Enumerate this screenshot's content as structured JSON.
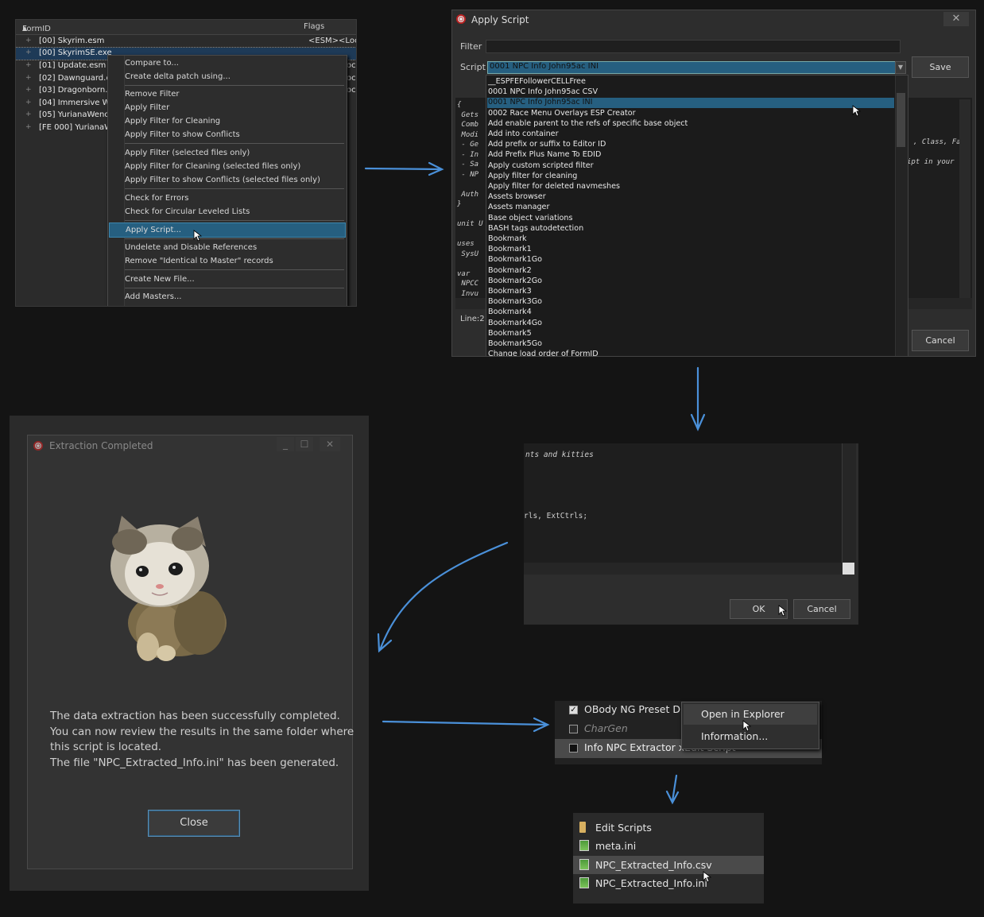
{
  "panel1": {
    "col_formid": "FormID",
    "col_flags": "Flags",
    "rows": [
      {
        "name": "[00] Skyrim.esm",
        "flags": "<ESM><Loc",
        "oc": ""
      },
      {
        "name": "[00] SkyrimSE.exe",
        "flags": "",
        "oc": ""
      },
      {
        "name": "[01] Update.esm",
        "flags": "",
        "oc": "oc"
      },
      {
        "name": "[02] Dawnguard.e",
        "flags": "",
        "oc": "oc"
      },
      {
        "name": "[03] Dragonborn.e",
        "flags": "",
        "oc": "oc"
      },
      {
        "name": "[04] Immersive W",
        "flags": "",
        "oc": ""
      },
      {
        "name": "[05] YurianaWencl",
        "flags": "",
        "oc": ""
      },
      {
        "name": "[FE 000] YurianaW",
        "flags": "",
        "oc": ""
      }
    ],
    "menu": [
      "Compare to...",
      "Create delta patch using...",
      "Remove Filter",
      "Apply Filter",
      "Apply Filter for Cleaning",
      "Apply Filter to show Conflicts",
      "Apply Filter (selected files only)",
      "Apply Filter for Cleaning (selected files only)",
      "Apply Filter to show Conflicts (selected files only)",
      "Check for Errors",
      "Check for Circular Leveled Lists",
      "Apply Script...",
      "Undelete and Disable References",
      "Remove \"Identical to Master\" records",
      "Create New File...",
      "Add Masters..."
    ]
  },
  "panel2": {
    "title": "Apply Script",
    "filter_label": "Filter",
    "script_label": "Script",
    "selected_script": "0001 NPC Info John95ac INI",
    "save_label": "Save",
    "cancel_label": "Cancel",
    "status": "Line:2",
    "code_left": [
      "{",
      "Gets",
      "Comb",
      "Modi",
      "- Ge",
      "- In",
      "- Sa",
      "- NP",
      "Auth",
      "}",
      "unit U",
      "uses",
      "SysU",
      "var",
      "NPCC",
      "Invu"
    ],
    "code_right1": ", Class, Fa",
    "code_right2": "ipt in your",
    "scripts": [
      "__ESPFEFollowerCELLFree",
      "0001 NPC Info John95ac CSV",
      "0001 NPC Info John95ac INI",
      "0002 Race Menu Overlays ESP Creator",
      "Add enable parent to the refs of specific base object",
      "Add into container",
      "Add prefix or suffix to Editor ID",
      "Add Prefix Plus Name To EDID",
      "Apply custom scripted filter",
      "Apply filter for cleaning",
      "Apply filter for deleted navmeshes",
      "Assets browser",
      "Assets manager",
      "Base object variations",
      "BASH tags autodetection",
      "Bookmark",
      "Bookmark1",
      "Bookmark1Go",
      "Bookmark2",
      "Bookmark2Go",
      "Bookmark3",
      "Bookmark3Go",
      "Bookmark4",
      "Bookmark4Go",
      "Bookmark5",
      "Bookmark5Go",
      "Change load order of FormID"
    ]
  },
  "panel3": {
    "title": "Extraction Completed",
    "lines": [
      "The data extraction has been successfully completed.",
      "You can now review the results in the same folder where",
      "this script is located.",
      "The file \"NPC_Extracted_Info.ini\" has been generated."
    ],
    "close_label": "Close"
  },
  "panel4": {
    "code1": "nts and kitties",
    "code2": "rls, ExtCtrls;",
    "ok_label": "OK",
    "cancel_label": "Cancel"
  },
  "panel5": {
    "mods": [
      {
        "name": "OBody NG Preset Di",
        "checked": true
      },
      {
        "name": "CharGen",
        "checked": false
      },
      {
        "name": "Info NPC Extractor xEdit Script",
        "checked": false
      }
    ],
    "menu": [
      "Open in Explorer",
      "Information..."
    ]
  },
  "panel6": {
    "files": [
      "Edit Scripts",
      "meta.ini",
      "NPC_Extracted_Info.csv",
      "NPC_Extracted_Info.ini"
    ]
  },
  "colors": {
    "accent": "#265f80",
    "arrow": "#4a90d9"
  }
}
